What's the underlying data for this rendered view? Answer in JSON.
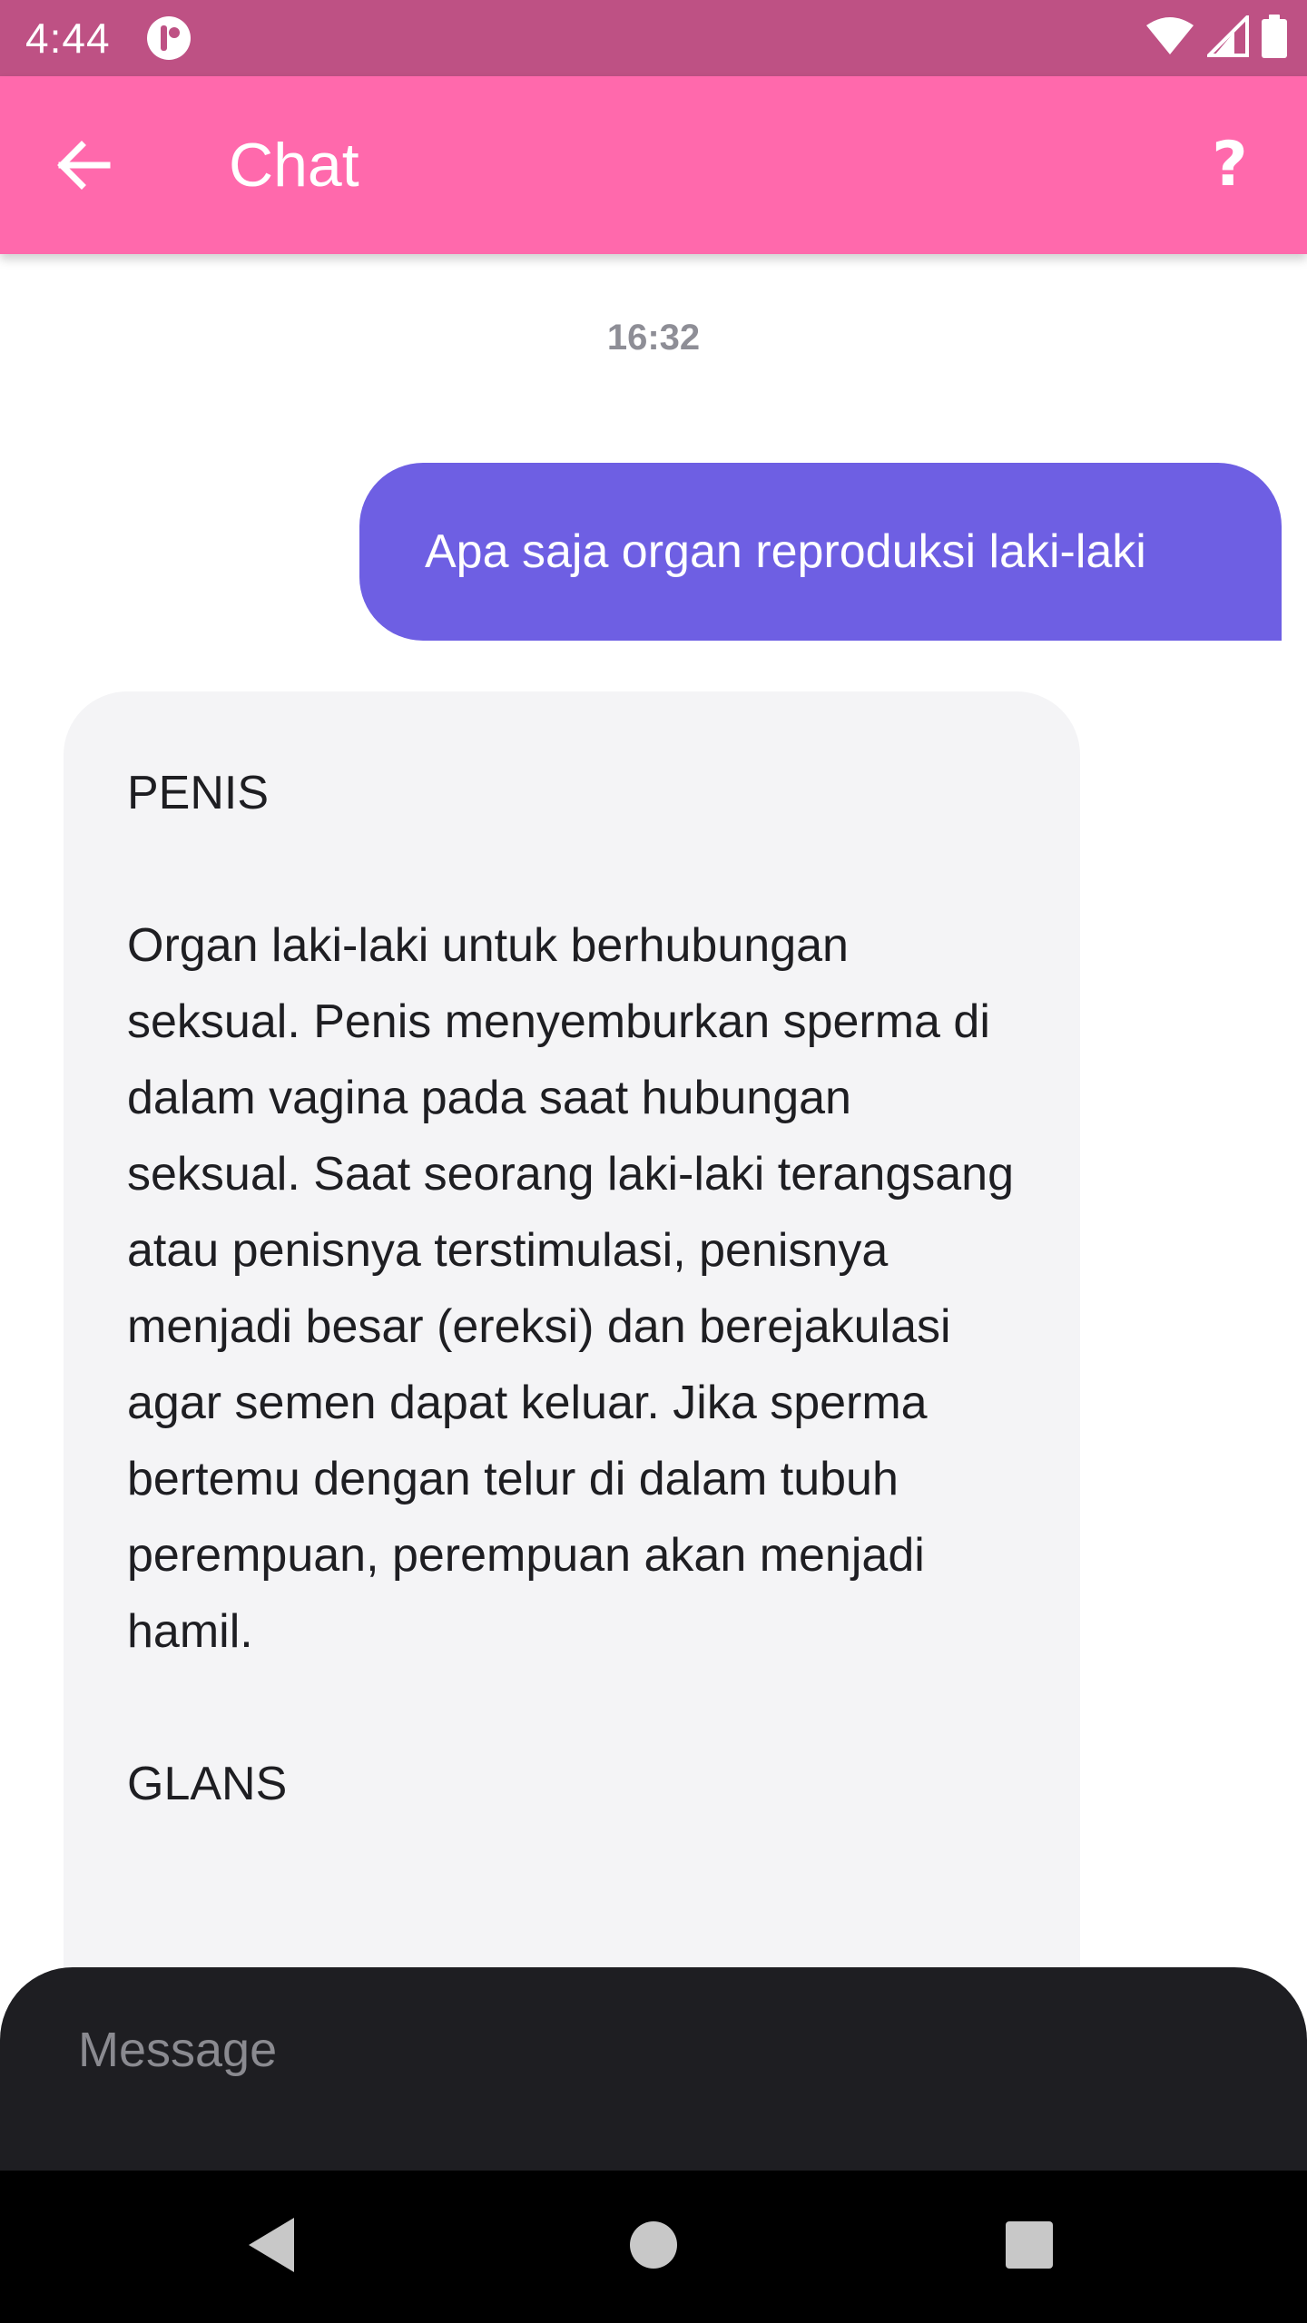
{
  "status_bar": {
    "time": "4:44",
    "icons": [
      "app-notification-icon",
      "wifi-icon",
      "cell-signal-icon",
      "battery-icon"
    ]
  },
  "app_bar": {
    "title": "Chat",
    "back_icon": "arrow-back-icon",
    "help_label": "?"
  },
  "chat": {
    "timestamp": "16:32",
    "messages": [
      {
        "sender": "user",
        "text": "Apa saja organ reproduksi laki-laki"
      },
      {
        "sender": "bot",
        "heading_1": "PENIS",
        "paragraph_1": "Organ laki-laki untuk berhubungan seksual. Penis menyemburkan sperma di dalam vagina pada saat hubungan seksual. Saat seorang laki-laki terangsang atau penisnya terstimulasi, penisnya menjadi besar (ereksi) dan berejakulasi agar semen dapat keluar. Jika sperma bertemu dengan telur di dalam tubuh perempuan, perempuan akan menjadi hamil.",
        "heading_2": "GLANS"
      }
    ]
  },
  "composer": {
    "placeholder": "Message",
    "value": ""
  },
  "nav_bar": {
    "buttons": [
      "back-triangle-icon",
      "home-circle-icon",
      "recents-square-icon"
    ]
  },
  "colors": {
    "status_bar": "#BE5184",
    "app_bar": "#FF69AC",
    "user_bubble": "#6E5FE3",
    "bot_bubble": "#F4F4F6",
    "composer": "#1E1E22"
  }
}
